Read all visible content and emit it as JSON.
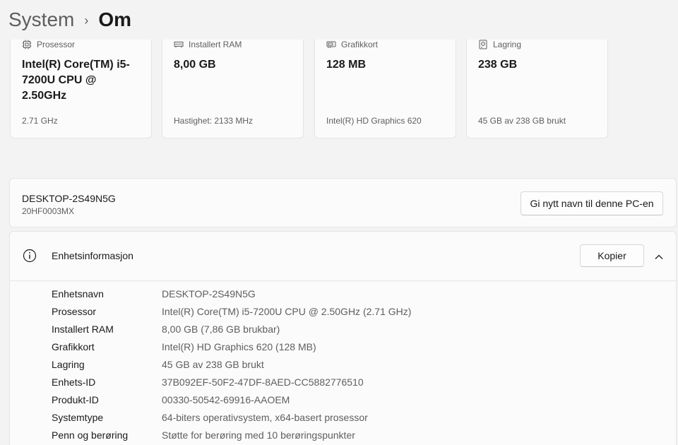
{
  "breadcrumb": {
    "parent": "System",
    "separator": "›",
    "current": "Om"
  },
  "cards": [
    {
      "icon": "processor-icon",
      "label": "Prosessor",
      "value": "Intel(R) Core(TM) i5-7200U CPU @ 2.50GHz",
      "sub": "2.71 GHz"
    },
    {
      "icon": "ram-icon",
      "label": "Installert RAM",
      "value": "8,00 GB",
      "sub": "Hastighet: 2133 MHz"
    },
    {
      "icon": "graphics-card-icon",
      "label": "Grafikkort",
      "value": "128 MB",
      "sub": "Intel(R) HD Graphics 620"
    },
    {
      "icon": "storage-icon",
      "label": "Lagring",
      "value": "238 GB",
      "sub": "45 GB av 238 GB brukt"
    }
  ],
  "pc": {
    "name": "DESKTOP-2S49N5G",
    "model": "20HF0003MX",
    "rename_label": "Gi nytt navn til denne PC-en"
  },
  "device_info": {
    "title": "Enhetsinformasjon",
    "copy_label": "Kopier",
    "rows": [
      {
        "label": "Enhetsnavn",
        "value": "DESKTOP-2S49N5G"
      },
      {
        "label": "Prosessor",
        "value": "Intel(R) Core(TM) i5-7200U CPU @ 2.50GHz (2.71 GHz)"
      },
      {
        "label": "Installert RAM",
        "value": "8,00 GB (7,86 GB brukbar)"
      },
      {
        "label": "Grafikkort",
        "value": "Intel(R) HD Graphics 620 (128 MB)"
      },
      {
        "label": "Lagring",
        "value": "45 GB av 238 GB brukt"
      },
      {
        "label": "Enhets-ID",
        "value": "37B092EF-50F2-47DF-8AED-CC5882776510"
      },
      {
        "label": "Produkt-ID",
        "value": "00330-50542-69916-AAOEM"
      },
      {
        "label": "Systemtype",
        "value": "64-biters operativsystem, x64-basert prosessor"
      },
      {
        "label": "Penn og berøring",
        "value": "Støtte for berøring med 10 berøringspunkter"
      }
    ]
  }
}
